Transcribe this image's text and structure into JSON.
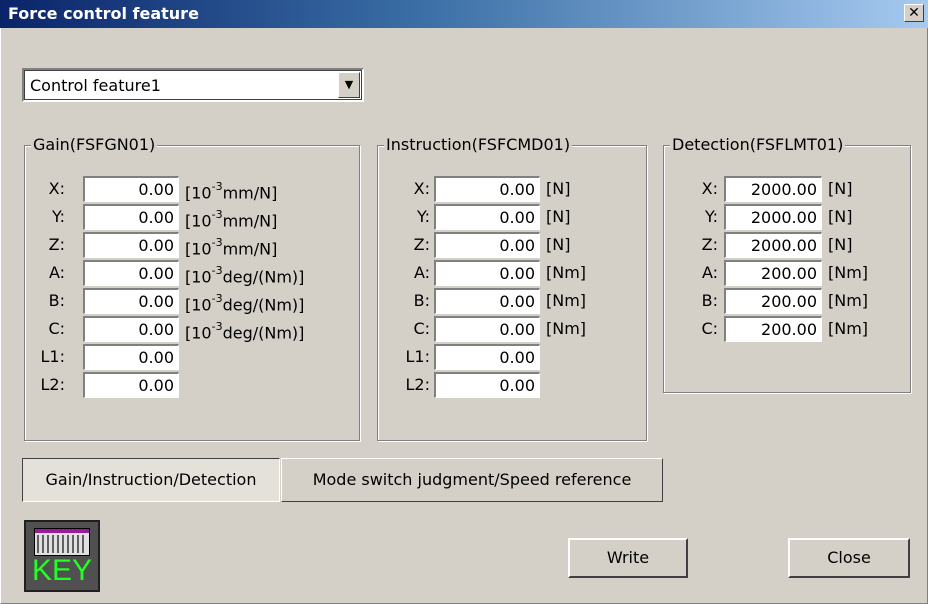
{
  "window": {
    "title": "Force control feature",
    "close_glyph": "✕"
  },
  "feature_select": {
    "value": "Control feature1",
    "arrow": "▼"
  },
  "gain": {
    "title": "Gain(FSFGN01)",
    "rows": [
      {
        "label": "X:",
        "value": "0.00",
        "unit_pre": "[10",
        "unit_sup": "-3",
        "unit_post": "mm/N]"
      },
      {
        "label": "Y:",
        "value": "0.00",
        "unit_pre": "[10",
        "unit_sup": "-3",
        "unit_post": "mm/N]"
      },
      {
        "label": "Z:",
        "value": "0.00",
        "unit_pre": "[10",
        "unit_sup": "-3",
        "unit_post": "mm/N]"
      },
      {
        "label": "A:",
        "value": "0.00",
        "unit_pre": "[10",
        "unit_sup": "-3",
        "unit_post": "deg/(Nm)]"
      },
      {
        "label": "B:",
        "value": "0.00",
        "unit_pre": "[10",
        "unit_sup": "-3",
        "unit_post": "deg/(Nm)]"
      },
      {
        "label": "C:",
        "value": "0.00",
        "unit_pre": "[10",
        "unit_sup": "-3",
        "unit_post": "deg/(Nm)]"
      },
      {
        "label": "L1:",
        "value": "0.00"
      },
      {
        "label": "L2:",
        "value": "0.00"
      }
    ]
  },
  "instruction": {
    "title": "Instruction(FSFCMD01)",
    "rows": [
      {
        "label": "X:",
        "value": "0.00",
        "unit": "[N]"
      },
      {
        "label": "Y:",
        "value": "0.00",
        "unit": "[N]"
      },
      {
        "label": "Z:",
        "value": "0.00",
        "unit": "[N]"
      },
      {
        "label": "A:",
        "value": "0.00",
        "unit": "[Nm]"
      },
      {
        "label": "B:",
        "value": "0.00",
        "unit": "[Nm]"
      },
      {
        "label": "C:",
        "value": "0.00",
        "unit": "[Nm]"
      },
      {
        "label": "L1:",
        "value": "0.00"
      },
      {
        "label": "L2:",
        "value": "0.00"
      }
    ]
  },
  "detection": {
    "title": "Detection(FSFLMT01)",
    "rows": [
      {
        "label": "X:",
        "value": "2000.00",
        "unit": "[N]"
      },
      {
        "label": "Y:",
        "value": "2000.00",
        "unit": "[N]"
      },
      {
        "label": "Z:",
        "value": "2000.00",
        "unit": "[N]"
      },
      {
        "label": "A:",
        "value": "200.00",
        "unit": "[Nm]"
      },
      {
        "label": "B:",
        "value": "200.00",
        "unit": "[Nm]"
      },
      {
        "label": "C:",
        "value": "200.00",
        "unit": "[Nm]"
      }
    ]
  },
  "tabs": [
    {
      "label": "Gain/Instruction/Detection",
      "active": true
    },
    {
      "label": "Mode switch judgment/Speed reference",
      "active": false
    }
  ],
  "buttons": {
    "write": "Write",
    "close": "Close"
  },
  "key_button": {
    "icon": "keyboard-icon",
    "label": "KEY",
    "label_color": "#22ff22"
  }
}
